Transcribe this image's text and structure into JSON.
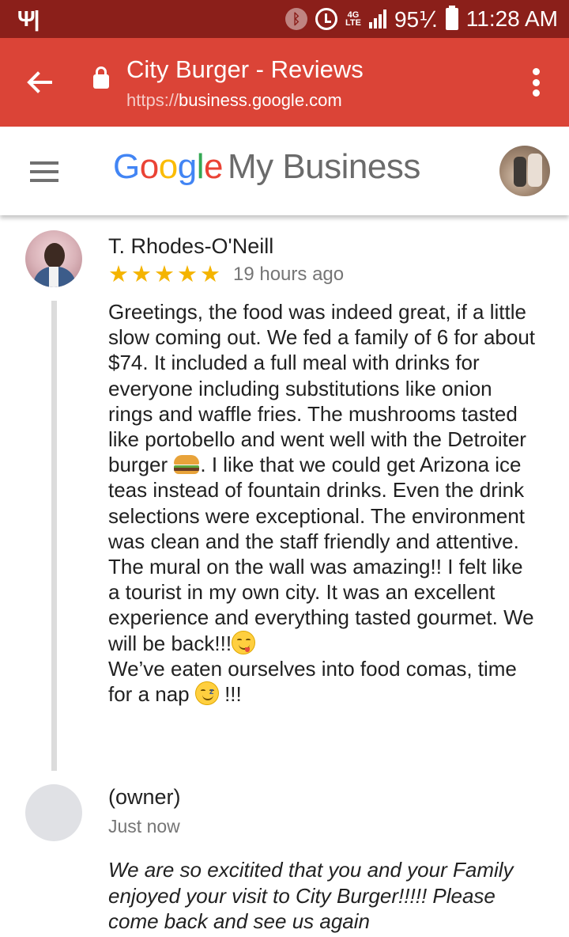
{
  "status_bar": {
    "left_icon": "fork-knife-icon",
    "network_label": "4G LTE",
    "battery": "95%",
    "battery_display": "95⅟.",
    "time": "11:28 AM"
  },
  "app_bar": {
    "title": "City Burger - Reviews",
    "url_scheme": "https://",
    "url_host": "business.google.com"
  },
  "header": {
    "brand": {
      "g1": "G",
      "o1": "o",
      "o2": "o",
      "g2": "g",
      "l": "l",
      "e": "e"
    },
    "product": "My Business",
    "colors": {
      "blue": "#4285f4",
      "red": "#ea4335",
      "yellow": "#fbbc05",
      "green": "#34a853"
    }
  },
  "review": {
    "author": "T. Rhodes-O'Neill",
    "rating": 5,
    "rating_max": 5,
    "time": "19 hours ago",
    "body_part1": "Greetings, the food was indeed great, if a little slow coming out. We fed a family of 6 for about $74. It included a full meal with drinks for everyone including substitutions like onion rings and waffle fries. The mushrooms tasted like portobello and went well with the Detroiter burger ",
    "body_part2": ". I like that we could get Arizona ice teas instead of fountain drinks. Even the drink selections were exceptional. The environment was clean and the staff friendly and attentive. The mural on the wall was amazing!! I felt like a tourist in my own city. It was an excellent experience and everything tasted gourmet. We will be back!!!",
    "body_part3": "We’ve eaten ourselves into food comas, time for a nap ",
    "body_part4": " !!!"
  },
  "owner_reply": {
    "author": "(owner)",
    "time": "Just now",
    "body": "We are so excitited that you and your Family enjoyed your visit to City Burger!!!!! Please come back and see us again"
  },
  "theme": {
    "status_bar_bg": "#8b1f1a",
    "app_bar_bg": "#db4437",
    "star_color": "#f4b400"
  }
}
